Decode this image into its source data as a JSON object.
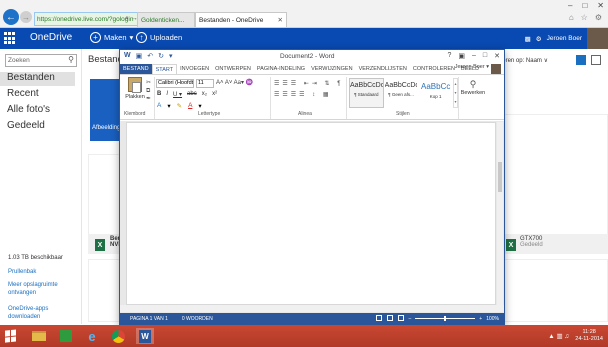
{
  "browser": {
    "address_url": "https://onedrive.live.com/?gologin",
    "address_controls": "⌕ → ▣ ·",
    "tabs": [
      {
        "label": "Goldenticken..."
      },
      {
        "label": "Bestanden - OneDrive"
      }
    ],
    "window_controls": [
      "–",
      "□",
      "✕"
    ],
    "tools": [
      "⌂",
      "☆",
      "⚙"
    ]
  },
  "onedrive": {
    "app_title": "OneDrive",
    "create_label": "Maken",
    "upload_label": "Uploaden",
    "user_name": "Jeroen Boer",
    "search_placeholder": "Zoeken",
    "nav": [
      {
        "label": "Bestanden"
      },
      {
        "label": "Recent"
      },
      {
        "label": "Alle foto's"
      },
      {
        "label": "Gedeeld"
      }
    ],
    "storage_text": "1.03 TB beschikbaar",
    "links": {
      "recycle": "Prullenbak",
      "more_storage": "Meer opslagruimte ontvangen",
      "apps": "OneDrive-apps downloaden"
    },
    "main_title": "Bestanden",
    "sort_label": "Sorteren op: Naam ∨",
    "tiles": {
      "blue_label": "Afbeeldingen",
      "left_file_label": "Beno NVIE",
      "right_file_name": "GTX700",
      "right_file_sub": "Gedeeld"
    }
  },
  "word": {
    "title": "Document2 - Word",
    "qat": [
      "W",
      "▣",
      "↶",
      "↻",
      "▾"
    ],
    "window_controls": [
      "?",
      "▣",
      "–",
      "□",
      "✕"
    ],
    "tabs": [
      {
        "label": "BESTAND"
      },
      {
        "label": "START"
      },
      {
        "label": "INVOEGEN"
      },
      {
        "label": "ONTWERPEN"
      },
      {
        "label": "PAGINA-INDELING"
      },
      {
        "label": "VERWIJZINGEN"
      },
      {
        "label": "VERZENDLIJSTEN"
      },
      {
        "label": "CONTROLEREN"
      },
      {
        "label": "BEELD"
      }
    ],
    "user": "Jeroen Boer ▾",
    "ribbon": {
      "paste_label": "Plakken",
      "clip_icons": "✂\n⧉\n✒",
      "font_name": "Calibri (Hoofdt",
      "font_size": "11",
      "font_row1_extra": "A˄ A˅ Aa▾ ♒",
      "font_row2": [
        "B",
        "I",
        "U ▾",
        "abc",
        "x₂",
        "x²"
      ],
      "font_row3": [
        "A",
        "▾",
        "✎",
        "A",
        "▾"
      ],
      "para_icons": "☰☰☰ ⇤⇥ ⇅ ¶ ☰☰☰☰ ↕ ▦",
      "styles": [
        {
          "sample": "AaBbCcDc",
          "name": "¶ Standaard"
        },
        {
          "sample": "AaBbCcDc",
          "name": "¶ Geen afs..."
        },
        {
          "sample": "AaBbCc",
          "name": "Kop 1"
        }
      ],
      "edit_label": "Bewerken",
      "group_clipboard": "Klembord",
      "group_font": "Lettertype",
      "group_paragraph": "Alinea",
      "group_styles": "Stijlen"
    },
    "status": {
      "page": "PAGINA 1 VAN 1",
      "words": "0 WOORDEN",
      "zoom": "100%"
    }
  },
  "taskbar": {
    "ie_glyph": "e",
    "word_glyph": "W",
    "tray_icons": "▲ ▥ ♫",
    "clock_time": "11:28",
    "clock_date": "24-11-2014"
  }
}
